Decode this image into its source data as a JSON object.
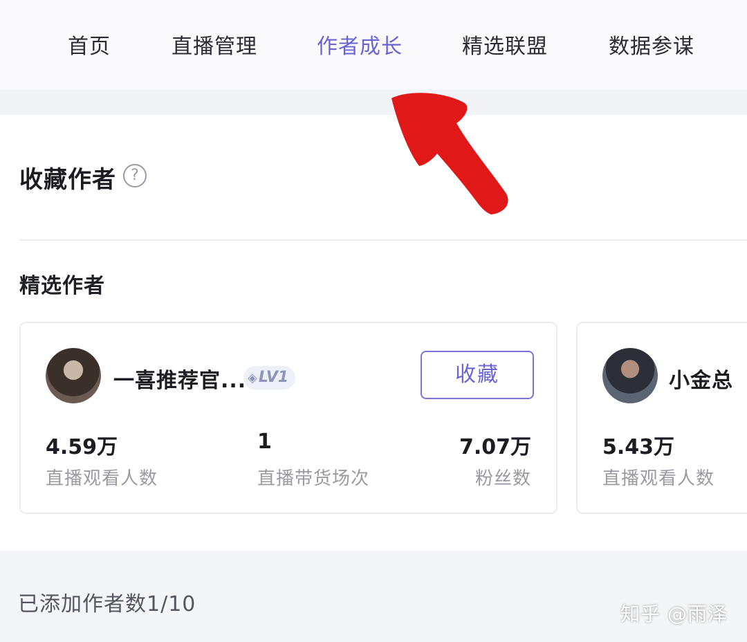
{
  "nav": {
    "tabs": [
      {
        "label": "首页"
      },
      {
        "label": "直播管理"
      },
      {
        "label": "作者成长",
        "active": true
      },
      {
        "label": "精选联盟"
      },
      {
        "label": "数据参谋"
      }
    ],
    "active_color": "#6a63d6"
  },
  "section": {
    "title": "收藏作者",
    "help_glyph": "?",
    "subtitle": "精选作者"
  },
  "cards": [
    {
      "name": "一喜推荐官...",
      "level": "LV1",
      "level_icon": "diamond-icon",
      "favorite_label": "收藏",
      "stats": [
        {
          "value": "4.59万",
          "label": "直播观看人数"
        },
        {
          "value": "1",
          "label": "直播带货场次"
        },
        {
          "value": "7.07万",
          "label": "粉丝数"
        }
      ]
    },
    {
      "name": "小金总",
      "stats": [
        {
          "value": "5.43万",
          "label": "直播观看人数"
        }
      ]
    }
  ],
  "footer": {
    "added_count": "已添加作者数1/10"
  },
  "watermark": "知乎 @雨泽",
  "annotation": {
    "color": "#e01818",
    "shape": "arrow-pointing-up-left"
  }
}
